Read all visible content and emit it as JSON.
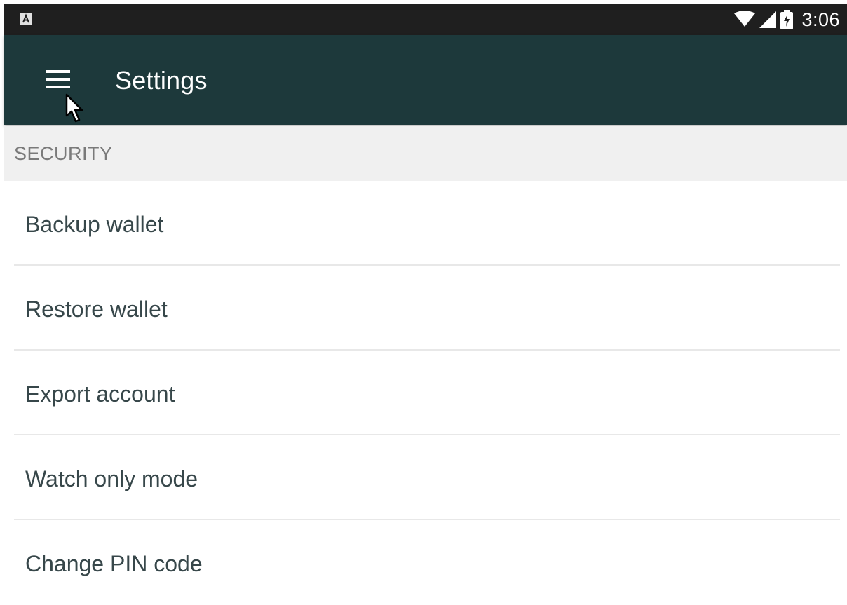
{
  "status_bar": {
    "time": "3:06",
    "left_icon": "notification-a-icon",
    "icons": [
      "wifi-icon",
      "cell-signal-icon",
      "battery-charging-icon"
    ]
  },
  "toolbar": {
    "title": "Settings",
    "menu_icon": "hamburger-menu-icon",
    "background_color": "#1d393b"
  },
  "section": {
    "header": "SECURITY"
  },
  "items": [
    {
      "label": "Backup wallet"
    },
    {
      "label": "Restore wallet"
    },
    {
      "label": "Export account"
    },
    {
      "label": "Watch only mode"
    },
    {
      "label": "Change PIN code"
    }
  ],
  "colors": {
    "status_bar": "#1f1f1f",
    "section_header_bg": "#f0f0f0",
    "item_text": "#37474a",
    "section_text": "#7a7a7a"
  }
}
